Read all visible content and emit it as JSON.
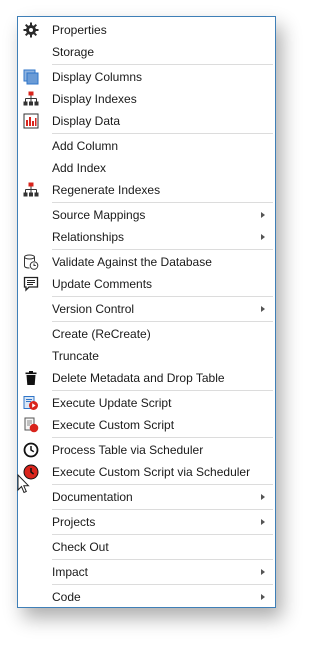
{
  "menu": {
    "items": [
      {
        "label": "Properties"
      },
      {
        "label": "Storage"
      },
      {
        "label": "Display Columns"
      },
      {
        "label": "Display Indexes"
      },
      {
        "label": "Display Data"
      },
      {
        "label": "Add Column"
      },
      {
        "label": "Add Index"
      },
      {
        "label": "Regenerate Indexes"
      },
      {
        "label": "Source Mappings"
      },
      {
        "label": "Relationships"
      },
      {
        "label": "Validate Against the Database"
      },
      {
        "label": "Update Comments"
      },
      {
        "label": "Version Control"
      },
      {
        "label": "Create (ReCreate)"
      },
      {
        "label": "Truncate"
      },
      {
        "label": "Delete Metadata and Drop Table"
      },
      {
        "label": "Execute Update Script"
      },
      {
        "label": "Execute Custom Script"
      },
      {
        "label": "Process Table via Scheduler"
      },
      {
        "label": "Execute Custom Script via Scheduler"
      },
      {
        "label": "Documentation"
      },
      {
        "label": "Projects"
      },
      {
        "label": "Check Out"
      },
      {
        "label": "Impact"
      },
      {
        "label": "Code"
      }
    ]
  },
  "colors": {
    "border": "#3f7fb7",
    "separator": "#dcdcdc",
    "accent_red": "#d9241c",
    "accent_blue": "#2f75c8"
  }
}
